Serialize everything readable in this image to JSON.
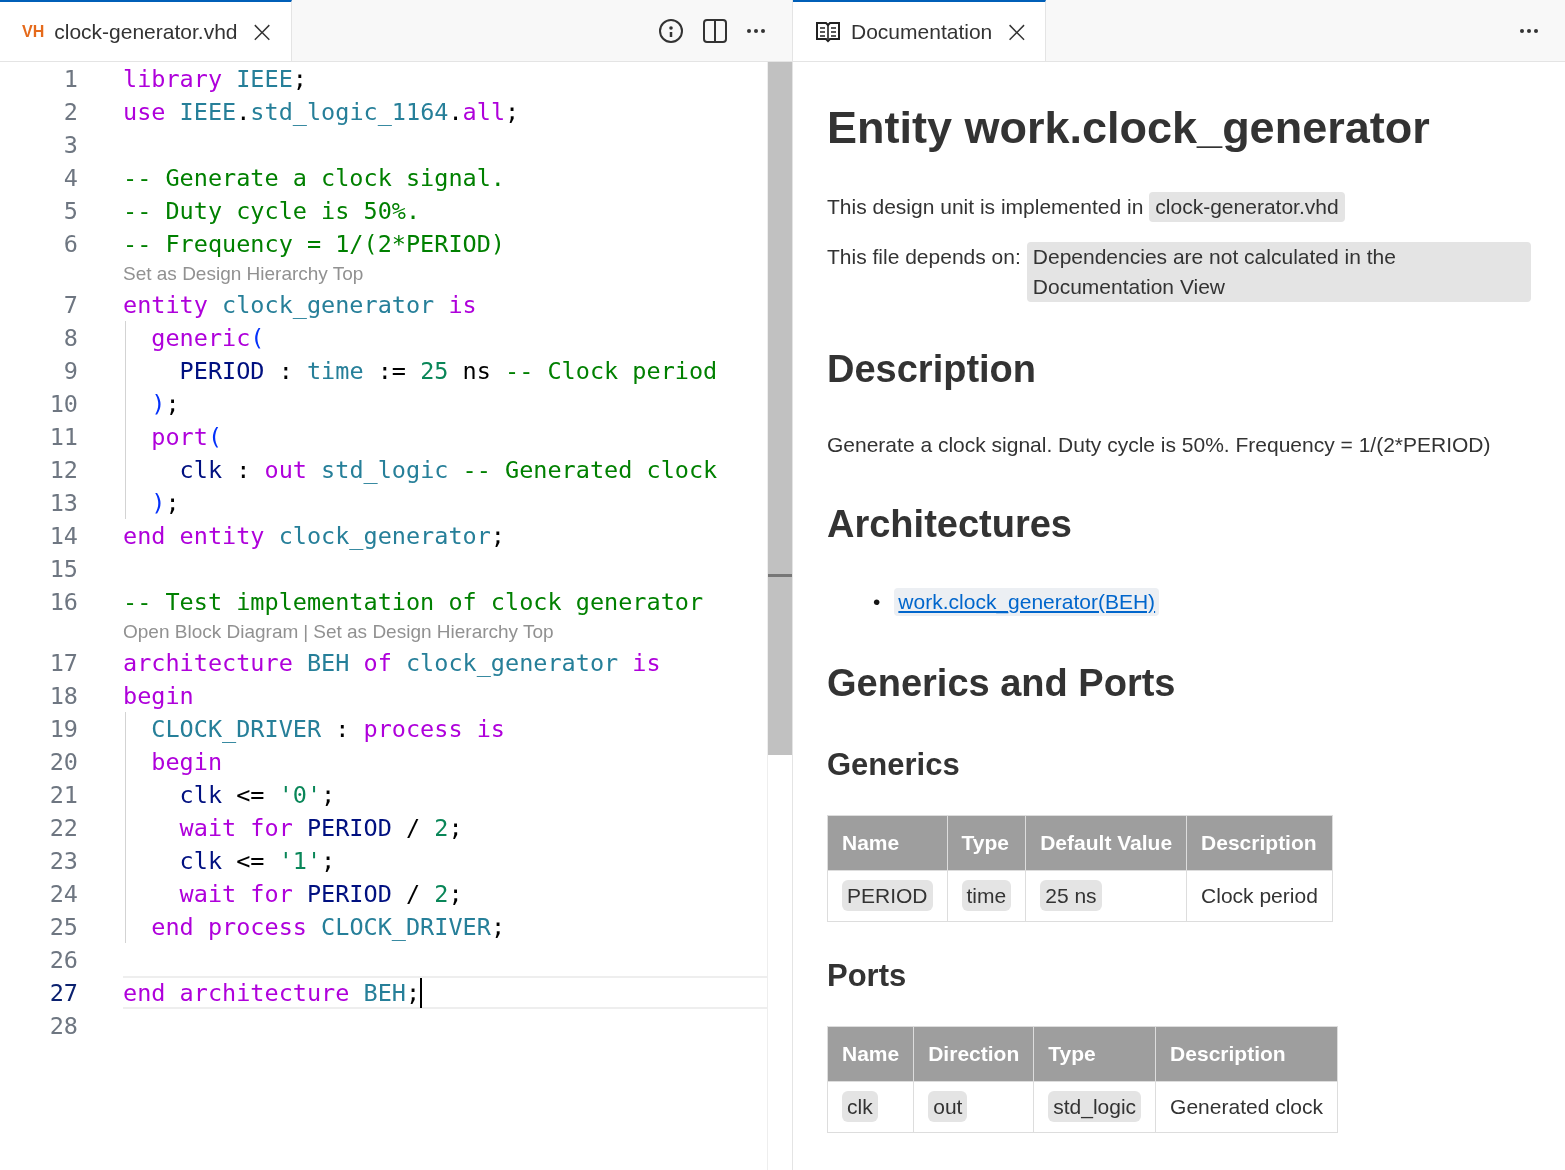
{
  "editor": {
    "tab": {
      "badge": "VH",
      "title": "clock-generator.vhd",
      "close": "×",
      "selected": true
    },
    "lines": [
      {
        "kind": "code",
        "number": "1",
        "current": false,
        "tokens": [
          {
            "kind": "keyword",
            "text": "library"
          },
          {
            "kind": "type",
            "text": " IEEE"
          },
          {
            "kind": "plain",
            "text": ";"
          }
        ]
      },
      {
        "kind": "code",
        "number": "2",
        "current": false,
        "tokens": [
          {
            "kind": "keyword",
            "text": "use"
          },
          {
            "kind": "type",
            "text": " IEEE"
          },
          {
            "kind": "plain",
            "text": "."
          },
          {
            "kind": "type",
            "text": "std_logic_1164"
          },
          {
            "kind": "plain",
            "text": "."
          },
          {
            "kind": "keyword",
            "text": "all"
          },
          {
            "kind": "plain",
            "text": ";"
          }
        ]
      },
      {
        "kind": "code",
        "number": "3",
        "current": false
      },
      {
        "kind": "code",
        "number": "4",
        "current": false,
        "tokens": [
          {
            "kind": "comment",
            "text": "-- Generate a clock signal."
          }
        ]
      },
      {
        "kind": "code",
        "number": "5",
        "current": false,
        "tokens": [
          {
            "kind": "comment",
            "text": "-- Duty cycle is 50%."
          }
        ]
      },
      {
        "kind": "code",
        "number": "6",
        "current": false,
        "tokens": [
          {
            "kind": "comment",
            "text": "-- Frequency = 1/(2*PERIOD)"
          }
        ]
      },
      {
        "kind": "lens",
        "links": [
          "Set as Design Hierarchy Top"
        ]
      },
      {
        "kind": "code",
        "number": "7",
        "current": false,
        "tokens": [
          {
            "kind": "keyword",
            "text": "entity"
          },
          {
            "kind": "type",
            "text": " clock_generator"
          },
          {
            "kind": "keyword",
            "text": " is"
          }
        ]
      },
      {
        "kind": "code",
        "number": "8",
        "current": false,
        "tokens": [
          {
            "kind": "keyword",
            "text": "  generic"
          },
          {
            "kind": "bracket",
            "text": "("
          }
        ]
      },
      {
        "kind": "code",
        "number": "9",
        "current": false,
        "tokens": [
          {
            "kind": "identifier",
            "text": "    PERIOD"
          },
          {
            "kind": "plain",
            "text": " : "
          },
          {
            "kind": "type",
            "text": "time"
          },
          {
            "kind": "plain",
            "text": " := "
          },
          {
            "kind": "number",
            "text": "25"
          },
          {
            "kind": "plain",
            "text": " ns "
          },
          {
            "kind": "comment",
            "text": "-- Clock period"
          }
        ]
      },
      {
        "kind": "code",
        "number": "10",
        "current": false,
        "tokens": [
          {
            "kind": "bracket",
            "text": "  )"
          },
          {
            "kind": "plain",
            "text": ";"
          }
        ]
      },
      {
        "kind": "code",
        "number": "11",
        "current": false,
        "tokens": [
          {
            "kind": "keyword",
            "text": "  port"
          },
          {
            "kind": "bracket",
            "text": "("
          }
        ]
      },
      {
        "kind": "code",
        "number": "12",
        "current": false,
        "tokens": [
          {
            "kind": "identifier",
            "text": "    clk"
          },
          {
            "kind": "plain",
            "text": " : "
          },
          {
            "kind": "keyword",
            "text": "out"
          },
          {
            "kind": "type",
            "text": " std_logic"
          },
          {
            "kind": "comment",
            "text": " -- Generated clock"
          }
        ]
      },
      {
        "kind": "code",
        "number": "13",
        "current": false,
        "tokens": [
          {
            "kind": "bracket",
            "text": "  )"
          },
          {
            "kind": "plain",
            "text": ";"
          }
        ]
      },
      {
        "kind": "code",
        "number": "14",
        "current": false,
        "tokens": [
          {
            "kind": "keyword",
            "text": "end entity"
          },
          {
            "kind": "type",
            "text": " clock_generator"
          },
          {
            "kind": "plain",
            "text": ";"
          }
        ]
      },
      {
        "kind": "code",
        "number": "15",
        "current": false
      },
      {
        "kind": "code",
        "number": "16",
        "current": false,
        "tokens": [
          {
            "kind": "comment",
            "text": "-- Test implementation of clock generator"
          }
        ]
      },
      {
        "kind": "lens",
        "links": [
          "Open Block Diagram",
          "Set as Design Hierarchy Top"
        ],
        "separator": "|"
      },
      {
        "kind": "code",
        "number": "17",
        "current": false,
        "tokens": [
          {
            "kind": "keyword",
            "text": "architecture"
          },
          {
            "kind": "type",
            "text": " BEH"
          },
          {
            "kind": "keyword",
            "text": " of"
          },
          {
            "kind": "type",
            "text": " clock_generator"
          },
          {
            "kind": "keyword",
            "text": " is"
          }
        ]
      },
      {
        "kind": "code",
        "number": "18",
        "current": false,
        "tokens": [
          {
            "kind": "keyword",
            "text": "begin"
          }
        ]
      },
      {
        "kind": "code",
        "number": "19",
        "current": false,
        "tokens": [
          {
            "kind": "type",
            "text": "  CLOCK_DRIVER"
          },
          {
            "kind": "plain",
            "text": " : "
          },
          {
            "kind": "keyword",
            "text": "process is"
          }
        ]
      },
      {
        "kind": "code",
        "number": "20",
        "current": false,
        "tokens": [
          {
            "kind": "keyword",
            "text": "  begin"
          }
        ]
      },
      {
        "kind": "code",
        "number": "21",
        "current": false,
        "tokens": [
          {
            "kind": "identifier",
            "text": "    clk"
          },
          {
            "kind": "plain",
            "text": " <= "
          },
          {
            "kind": "number",
            "text": "'0'"
          },
          {
            "kind": "plain",
            "text": ";"
          }
        ]
      },
      {
        "kind": "code",
        "number": "22",
        "current": false,
        "tokens": [
          {
            "kind": "keyword",
            "text": "    wait for"
          },
          {
            "kind": "identifier",
            "text": " PERIOD"
          },
          {
            "kind": "plain",
            "text": " / "
          },
          {
            "kind": "number",
            "text": "2"
          },
          {
            "kind": "plain",
            "text": ";"
          }
        ]
      },
      {
        "kind": "code",
        "number": "23",
        "current": false,
        "tokens": [
          {
            "kind": "identifier",
            "text": "    clk"
          },
          {
            "kind": "plain",
            "text": " <= "
          },
          {
            "kind": "number",
            "text": "'1'"
          },
          {
            "kind": "plain",
            "text": ";"
          }
        ]
      },
      {
        "kind": "code",
        "number": "24",
        "current": false,
        "tokens": [
          {
            "kind": "keyword",
            "text": "    wait for"
          },
          {
            "kind": "identifier",
            "text": " PERIOD"
          },
          {
            "kind": "plain",
            "text": " / "
          },
          {
            "kind": "number",
            "text": "2"
          },
          {
            "kind": "plain",
            "text": ";"
          }
        ]
      },
      {
        "kind": "code",
        "number": "25",
        "current": false,
        "tokens": [
          {
            "kind": "keyword",
            "text": "  end process"
          },
          {
            "kind": "type",
            "text": " CLOCK_DRIVER"
          },
          {
            "kind": "plain",
            "text": ";"
          }
        ]
      },
      {
        "kind": "code",
        "number": "26",
        "current": false
      },
      {
        "kind": "code",
        "number": "27",
        "current": true,
        "tokens": [
          {
            "kind": "keyword",
            "text": "end architecture"
          },
          {
            "kind": "type",
            "text": " BEH"
          },
          {
            "kind": "plain",
            "text": ";"
          }
        ]
      },
      {
        "kind": "code",
        "number": "28",
        "current": false
      }
    ]
  },
  "docs": {
    "tab": {
      "title": "Documentation",
      "close": "×",
      "selected": true
    },
    "title": "Entity work.clock_generator",
    "implemented": {
      "text": "This design unit is implemented in",
      "chip": "clock-generator.vhd"
    },
    "depends": {
      "text": "This file depends on:",
      "chip": "Dependencies are not calculated in the Documentation View"
    },
    "description_heading": "Description",
    "description": "Generate a clock signal. Duty cycle is 50%. Frequency = 1/(2*PERIOD)",
    "architectures_heading": "Architectures",
    "architectures": [
      {
        "bullet": "•",
        "link": "work.clock_generator(BEH)"
      }
    ],
    "gp_heading": "Generics and Ports",
    "generics": {
      "heading": "Generics",
      "columns": [
        "Name",
        "Type",
        "Default Value",
        "Description"
      ],
      "rows": [
        [
          {
            "text": "PERIOD",
            "chip": true
          },
          {
            "text": "time",
            "chip": true
          },
          {
            "text": "25 ns",
            "chip": true
          },
          {
            "text": "Clock period",
            "chip": false
          }
        ]
      ]
    },
    "ports": {
      "heading": "Ports",
      "columns": [
        "Name",
        "Direction",
        "Type",
        "Description"
      ],
      "rows": [
        [
          {
            "text": "clk",
            "chip": true
          },
          {
            "text": "out",
            "chip": true
          },
          {
            "text": "std_logic",
            "chip": true
          },
          {
            "text": "Generated clock",
            "chip": false
          }
        ]
      ]
    }
  }
}
